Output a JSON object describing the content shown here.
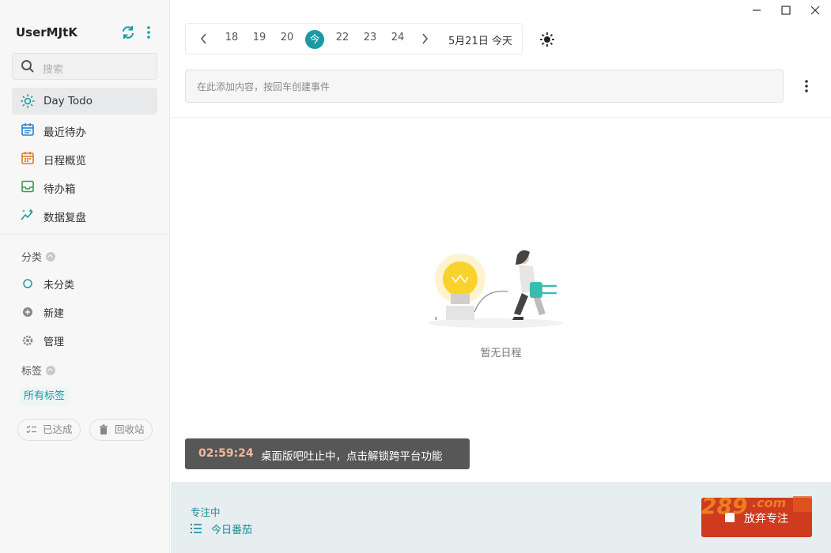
{
  "sidebar": {
    "username": "UserMJtK",
    "search_placeholder": "搜索",
    "nav": [
      {
        "label": "Day Todo",
        "icon": "sun-icon"
      },
      {
        "label": "最近待办",
        "icon": "calendar-list-icon"
      },
      {
        "label": "日程概览",
        "icon": "calendar-grid-icon"
      },
      {
        "label": "待办箱",
        "icon": "inbox-icon"
      },
      {
        "label": "数据复盘",
        "icon": "sparkle-chart-icon"
      }
    ],
    "category_heading": "分类",
    "category_items": [
      {
        "label": "未分类",
        "icon": "circle-outline-icon"
      },
      {
        "label": "新建",
        "icon": "plus-circle-icon"
      },
      {
        "label": "管理",
        "icon": "gear-icon"
      }
    ],
    "tag_heading": "标签",
    "all_tags": "所有标签",
    "done_label": "已达成",
    "trash_label": "回收站"
  },
  "date_bar": {
    "days": [
      "18",
      "19",
      "20",
      "今",
      "22",
      "23",
      "24"
    ],
    "current_label": "5月21日 今天"
  },
  "event_input": {
    "placeholder": "在此添加内容，按回车创建事件"
  },
  "empty_state": {
    "text": "暂无日程"
  },
  "timer": {
    "time": "02:59:24",
    "message": "桌面版吧吐止中，点击解锁跨平台功能"
  },
  "footer": {
    "focus_label": "专注中",
    "tomato_label": "今日番茄",
    "abandon_label": "放弃专注"
  },
  "colors": {
    "accent": "#1b9aa2",
    "abandon": "#cf3b1f",
    "timer_bg": "#575757"
  }
}
